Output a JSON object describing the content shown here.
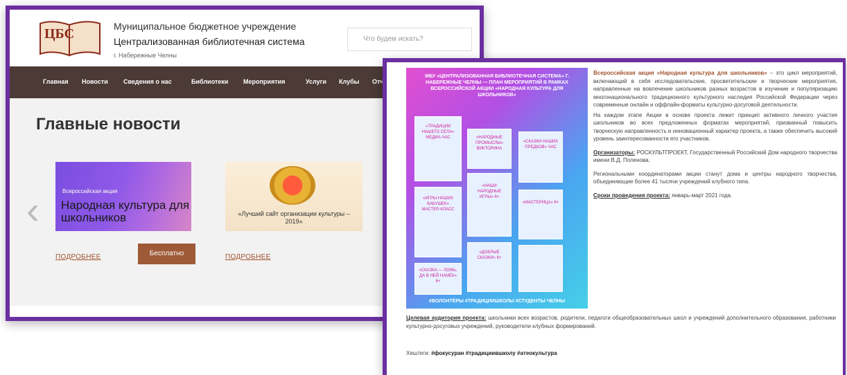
{
  "site": {
    "logo_text": "ЦБС",
    "org_line1": "Муниципальное бюджетное учреждение",
    "org_line2": "Централизованная библиотечная система",
    "org_line3": "г. Набережные Челны",
    "search_placeholder": "Что будем искать?"
  },
  "nav": {
    "items": [
      "Главная",
      "Новости",
      "Сведения о нас",
      "Библиотеки",
      "Мероприятия",
      "Услуги",
      "Клубы",
      "Отч"
    ]
  },
  "main": {
    "title": "Главные новости",
    "card1": {
      "small": "Всероссийская акция",
      "big": "Народная культура для школьников"
    },
    "card2": {
      "caption": "«Лучший сайт организации культуры – 2019»"
    },
    "more1": "ПОДРОБНЕЕ",
    "more2": "ПОДРОБНЕЕ",
    "free_button": "Бесплатно"
  },
  "poster": {
    "header": "МБУ «ЦЕНТРАЛИЗОВАННАЯ БИБЛИОТЕЧНАЯ СИСТЕМА» Г. НАБЕРЕЖНЫЕ ЧЕЛНЫ — ПЛАН МЕРОПРИЯТИЙ В РАМКАХ ВСЕРОССИЙСКОЙ АКЦИИ «НАРОДНАЯ КУЛЬТУРА ДЛЯ ШКОЛЬНИКОВ»",
    "tiles": [
      "«ТРАДИЦИИ НАШЕГО СЕЛА» МЕДИА-ЧАС",
      "«НАРОДНЫЕ ПРОМЫСЛЫ» ВИКТОРИНА",
      "«СКАЗКИ НАШИХ ПРЕДКОВ» ЧАС",
      "«ИГРЫ НАШИХ БАБУШЕК» МАСТЕР-КЛАСС",
      "«НАШИ НАРОДНЫЕ ИГРЫ» 6+",
      "«МАСТЕРИЦА» 6+",
      "«СКАЗКА — ЛОЖЬ, ДА В НЕЙ НАМЁК» 6+",
      "«ДОБРЫЕ СКАЗКИ» 6+"
    ],
    "footer": "#ВОЛОНТЁРЫ #ТРАДИЦИИШКОЛЫ #СТУДЕНТЫ ЧЕЛНЫ"
  },
  "article": {
    "heading": "Всероссийская акция «Народная культура для школьников»",
    "para1": " – это цикл мероприятий, включающий в себя исследовательские, просветительские и творческие мероприятия, направленные на вовлечение школьников разных возрастов в изучение и популяризацию многонационального традиционного культурного наследия Российской Федерации через современные онлайн и оффлайн-форматы культурно-досуговой деятельности.",
    "para2": "На каждом этапе Акции в основе проекта лежит принцип активного личного участия школьников во всех предложенных форматах мероприятий, призванный повысить творческую направленность и инновационный характер проекта, а также обеспечить высокий уровень заинтересованности его участников.",
    "org_label": "Организаторы:",
    "org_text": " РОСКУЛЬТПРОЕКТ, Государственный Российский Дом народного творчества имени В.Д. Поленова.",
    "para3": "Региональными координаторами акции станут дома и центры народного творчества, объединяющие более 41 тысячи учреждений клубного типа.",
    "period_label": "Сроки проведения проекта:",
    "period_text": " январь-март 2021 года.",
    "audience_label": "Целевая аудитория проекта:",
    "audience_text": " школьники всех возрастов, родители, педагоги общеобразовательных школ и учреждений дополнительного образования, работники культурно-досуговых учреждений, руководители клубных формирований.",
    "tags_label": "Хештеги:",
    "tags_text": " #фокусуран #традициившколу #атеокультура"
  },
  "colors": {
    "frame": "#6a2fa0",
    "nav": "#4b3a35",
    "accent": "#9e5a37"
  }
}
